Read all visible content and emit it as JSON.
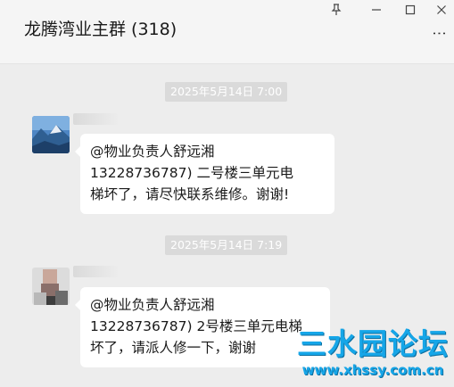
{
  "window": {
    "title": "龙腾湾业主群 (318)",
    "more_icon": "⋮"
  },
  "messages": [
    {
      "time": "2025年5月14日 7:00",
      "lines": [
        "@物业负责人舒远湘",
        "13228736787) 二号楼三单元电",
        "梯坏了，请尽快联系维修。谢谢!"
      ]
    },
    {
      "time": "2025年5月14日 7:19",
      "lines": [
        "@物业负责人舒远湘",
        "13228736787) 2号楼三单元电梯",
        "坏了，请派人修一下，谢谢"
      ]
    }
  ],
  "watermark": {
    "name": "三水园论坛",
    "url": "www.xhssy.com.cn"
  }
}
